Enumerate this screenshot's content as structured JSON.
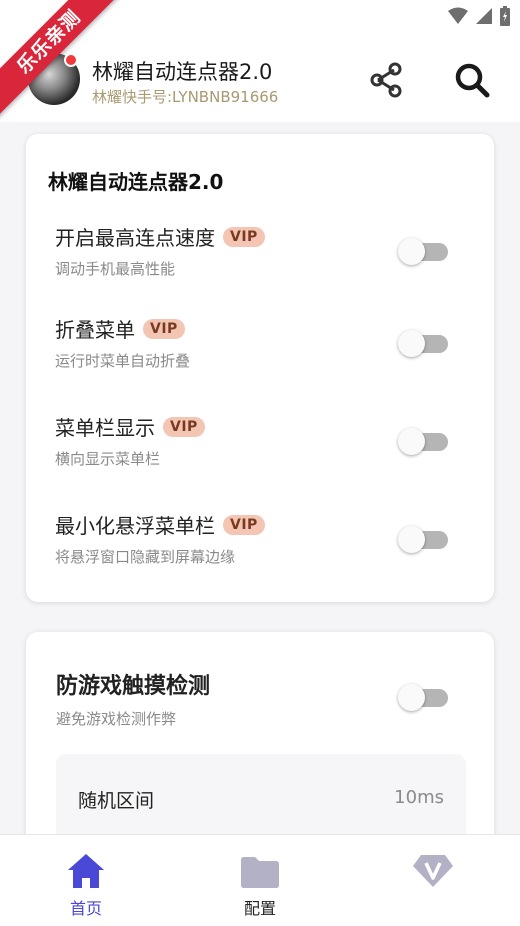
{
  "ribbon": {
    "text": "乐乐亲测"
  },
  "header": {
    "title": "林耀自动连点器2.0",
    "subtitle": "林耀快手号:LYNBNB91666",
    "share_icon": "share-icon",
    "search_icon": "search-icon"
  },
  "card1": {
    "title": "林耀自动连点器2.0",
    "settings": [
      {
        "label": "开启最高连点速度",
        "badge": "VIP",
        "desc": "调动手机最高性能",
        "enabled": false
      },
      {
        "label": "折叠菜单",
        "badge": "VIP",
        "desc": "运行时菜单自动折叠",
        "enabled": false
      },
      {
        "label": "菜单栏显示",
        "badge": "VIP",
        "desc": "横向显示菜单栏",
        "enabled": false
      },
      {
        "label": "最小化悬浮菜单栏",
        "badge": "VIP",
        "desc": "将悬浮窗口隐藏到屏幕边缘",
        "enabled": false
      }
    ]
  },
  "card2": {
    "title": "防游戏触摸检测",
    "desc": "避免游戏检测作弊",
    "enabled": false,
    "range": {
      "label": "随机区间",
      "value": "10ms"
    }
  },
  "nav": [
    {
      "label": "首页",
      "icon": "home-icon",
      "active": true
    },
    {
      "label": "配置",
      "icon": "folder-icon",
      "active": false
    },
    {
      "label": "",
      "icon": "vip-diamond-icon",
      "active": false
    }
  ],
  "colors": {
    "accent": "#4a48d6",
    "vip_badge_bg": "#f3c6b4",
    "vip_badge_text": "#7a3a22",
    "ribbon": "#d9263a",
    "subtitle": "#a89a70"
  }
}
